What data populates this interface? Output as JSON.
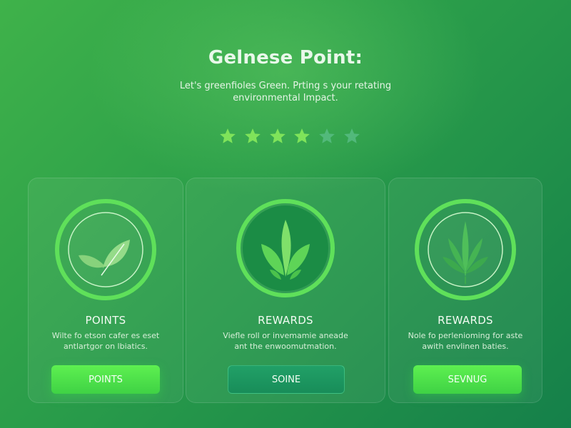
{
  "header": {
    "title": "Gelnese Point:",
    "subtitle_lines": [
      "Let's greenfioles Green. Prting s your retating",
      "environmental Impact."
    ]
  },
  "rating": {
    "value": 4,
    "max": 6
  },
  "colors": {
    "star_filled": "#7fe35a",
    "star_empty": "#5cc08a",
    "accent_bright": "#4fe24a",
    "accent_dark": "#1a9460"
  },
  "cards": [
    {
      "icon": "leaf-outline-icon",
      "title": "POINTS",
      "desc_lines": [
        "Wilte fo etson cafer es eset",
        "antlartgor on lbiatics."
      ],
      "button_label": "POINTS"
    },
    {
      "icon": "plant-sprout-icon",
      "title": "REWARDS",
      "desc_lines": [
        "Viefle roll or invemamie aneade",
        "ant the enwoomutmation."
      ],
      "button_label": "SOINE"
    },
    {
      "icon": "cannabis-leaf-icon",
      "title": "REWARDS",
      "desc_lines": [
        "Nole fo perlenioming for aste",
        "awith envlinen baties."
      ],
      "button_label": "SEVNUG"
    }
  ]
}
